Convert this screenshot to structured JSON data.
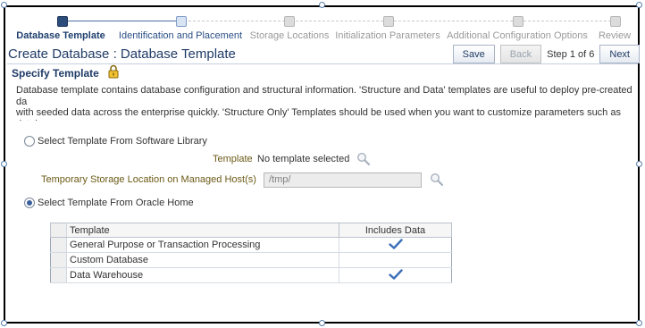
{
  "train": {
    "steps": [
      {
        "label": "Database Template",
        "state": "current"
      },
      {
        "label": "Identification and Placement",
        "state": "next"
      },
      {
        "label": "Storage Locations",
        "state": "disabled"
      },
      {
        "label": "Initialization Parameters",
        "state": "disabled"
      },
      {
        "label": "Additional Configuration Options",
        "state": "disabled"
      },
      {
        "label": "Review",
        "state": "disabled"
      }
    ]
  },
  "header": {
    "title": "Create Database : Database Template",
    "save_label": "Save",
    "back_label": "Back",
    "step_info": "Step 1 of 6",
    "next_label": "Next"
  },
  "section": {
    "title": "Specify Template",
    "description": "Database template contains database configuration and structural information. 'Structure and Data' templates are useful to deploy pre-created da\nwith seeded data across the enterprise quickly. 'Structure Only' Templates should be used when you want to customize parameters such as databa\nsize, datafiles, tablespace attributes, and database options when creating the database."
  },
  "options": {
    "software_library_label": "Select Template From Software Library",
    "software_library_checked": false,
    "template_label": "Template",
    "template_value": "No template selected",
    "temp_storage_label": "Temporary Storage Location on Managed Host(s)",
    "temp_storage_value": "/tmp/",
    "oracle_home_label": "Select Template From Oracle Home",
    "oracle_home_checked": true
  },
  "table": {
    "headers": [
      "Template",
      "Includes Data"
    ],
    "rows": [
      {
        "template": "General Purpose or Transaction Processing",
        "includes_data": true
      },
      {
        "template": "Custom Database",
        "includes_data": false
      },
      {
        "template": "Data Warehouse",
        "includes_data": true
      }
    ]
  },
  "colors": {
    "accent": "#1f3b66",
    "label_gold": "#6b5a16",
    "check": "#3b6fb8"
  },
  "icons": {
    "lock": "lock-icon",
    "search": "search-icon",
    "check": "checkmark-icon"
  }
}
